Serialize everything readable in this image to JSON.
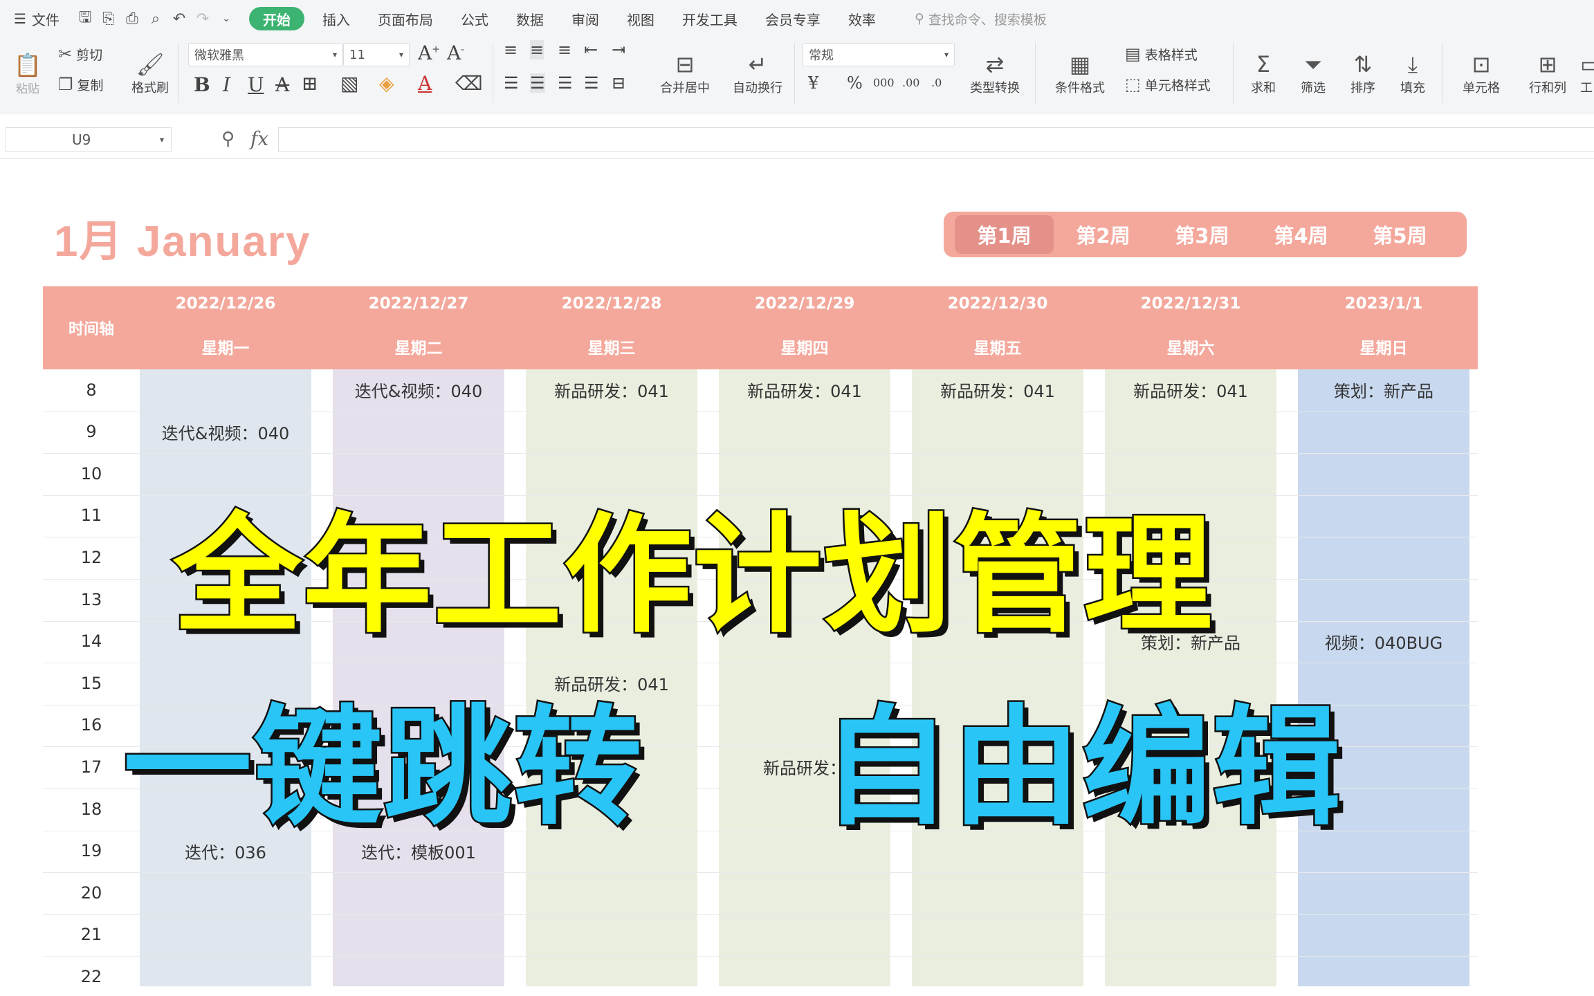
{
  "menubar": {
    "file_label": "文件",
    "tabs": [
      "开始",
      "插入",
      "页面布局",
      "公式",
      "数据",
      "审阅",
      "视图",
      "开发工具",
      "会员专享",
      "效率"
    ],
    "active_tab": "开始",
    "search_placeholder": "查找命令、搜索模板"
  },
  "toolbar": {
    "paste": "粘贴",
    "cut": "剪切",
    "copy": "复制",
    "format_painter": "格式刷",
    "font_name": "微软雅黑",
    "font_size": "11",
    "merge_center": "合并居中",
    "wrap_text": "自动换行",
    "number_format": "常规",
    "type_convert": "类型转换",
    "conditional_format": "条件格式",
    "table_style": "表格样式",
    "cell_style": "单元格样式",
    "sum": "求和",
    "filter": "筛选",
    "sort": "排序",
    "fill": "填充",
    "cell": "单元格",
    "rows_cols": "行和列",
    "work": "工"
  },
  "formula_bar": {
    "cell_ref": "U9",
    "fx": "fx",
    "value": ""
  },
  "sheet": {
    "month_title": "1月  January",
    "weeks": [
      "第1周",
      "第2周",
      "第3周",
      "第4周",
      "第5周"
    ],
    "active_week": 0,
    "axis_label": "时间轴",
    "days": [
      {
        "date": "2022/12/26",
        "weekday": "星期一",
        "color": "#dfe6ee"
      },
      {
        "date": "2022/12/27",
        "weekday": "星期二",
        "color": "#e5e0ec"
      },
      {
        "date": "2022/12/28",
        "weekday": "星期三",
        "color": "#e9eedf"
      },
      {
        "date": "2022/12/29",
        "weekday": "星期四",
        "color": "#e9eedf"
      },
      {
        "date": "2022/12/30",
        "weekday": "星期五",
        "color": "#e9eedf"
      },
      {
        "date": "2022/12/31",
        "weekday": "星期六",
        "color": "#e9eedf"
      },
      {
        "date": "2023/1/1",
        "weekday": "星期日",
        "color": "#c8d8ee"
      }
    ],
    "hours": [
      "8",
      "9",
      "10",
      "11",
      "12",
      "13",
      "14",
      "15",
      "16",
      "17",
      "18",
      "19",
      "20",
      "21",
      "22"
    ],
    "events": [
      {
        "day": 1,
        "hour": 0,
        "text": "迭代&视频：040"
      },
      {
        "day": 2,
        "hour": 0,
        "text": "新品研发：041"
      },
      {
        "day": 3,
        "hour": 0,
        "text": "新品研发：041"
      },
      {
        "day": 4,
        "hour": 0,
        "text": "新品研发：041"
      },
      {
        "day": 5,
        "hour": 0,
        "text": "新品研发：041"
      },
      {
        "day": 6,
        "hour": 0,
        "text": "策划：新产品"
      },
      {
        "day": 0,
        "hour": 1,
        "text": "迭代&视频：040"
      },
      {
        "day": 5,
        "hour": 6,
        "text": "策划：新产品"
      },
      {
        "day": 6,
        "hour": 6,
        "text": "视频：040BUG"
      },
      {
        "day": 2,
        "hour": 7,
        "text": "新品研发：041"
      },
      {
        "day": 3,
        "hour": 9,
        "text": "新品研发："
      },
      {
        "day": 0,
        "hour": 11,
        "text": "迭代：036"
      },
      {
        "day": 1,
        "hour": 11,
        "text": "迭代：模板001"
      }
    ]
  },
  "overlay": {
    "line1": "全年工作计划管理",
    "line2a": "一键跳转",
    "line2b": "自由编辑"
  }
}
